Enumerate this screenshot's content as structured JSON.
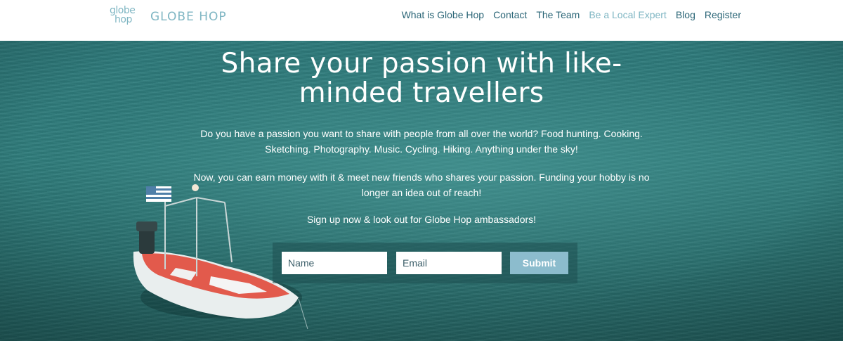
{
  "header": {
    "logo_mark_line1": "globe",
    "logo_mark_line2": "hop",
    "logo_text": "GLOBE HOP",
    "nav": [
      {
        "label": "What is Globe Hop"
      },
      {
        "label": "Contact"
      },
      {
        "label": "The Team"
      },
      {
        "label": "Be a Local Expert",
        "active": true
      },
      {
        "label": "Blog"
      },
      {
        "label": "Register"
      }
    ]
  },
  "hero": {
    "headline": "Share your passion with like-minded travellers",
    "paragraph1": "Do you have a passion you want to share with people from all over the world? Food hunting. Cooking. Sketching. Photography. Music. Cycling. Hiking. Anything under the sky!",
    "paragraph2": "Now, you can earn money with it & meet new friends who shares your passion. Funding your hobby is no longer an idea out of reach!",
    "paragraph3": "Sign up now & look out for Globe Hop ambassadors!"
  },
  "form": {
    "name_placeholder": "Name",
    "email_placeholder": "Email",
    "submit_label": "Submit"
  },
  "colors": {
    "brand": "#7fb6c3",
    "nav_text": "#2b6677",
    "hero_water": "#2e7b7c",
    "submit_bg": "#8cbccd",
    "boat_hull": "#e25a4c"
  }
}
